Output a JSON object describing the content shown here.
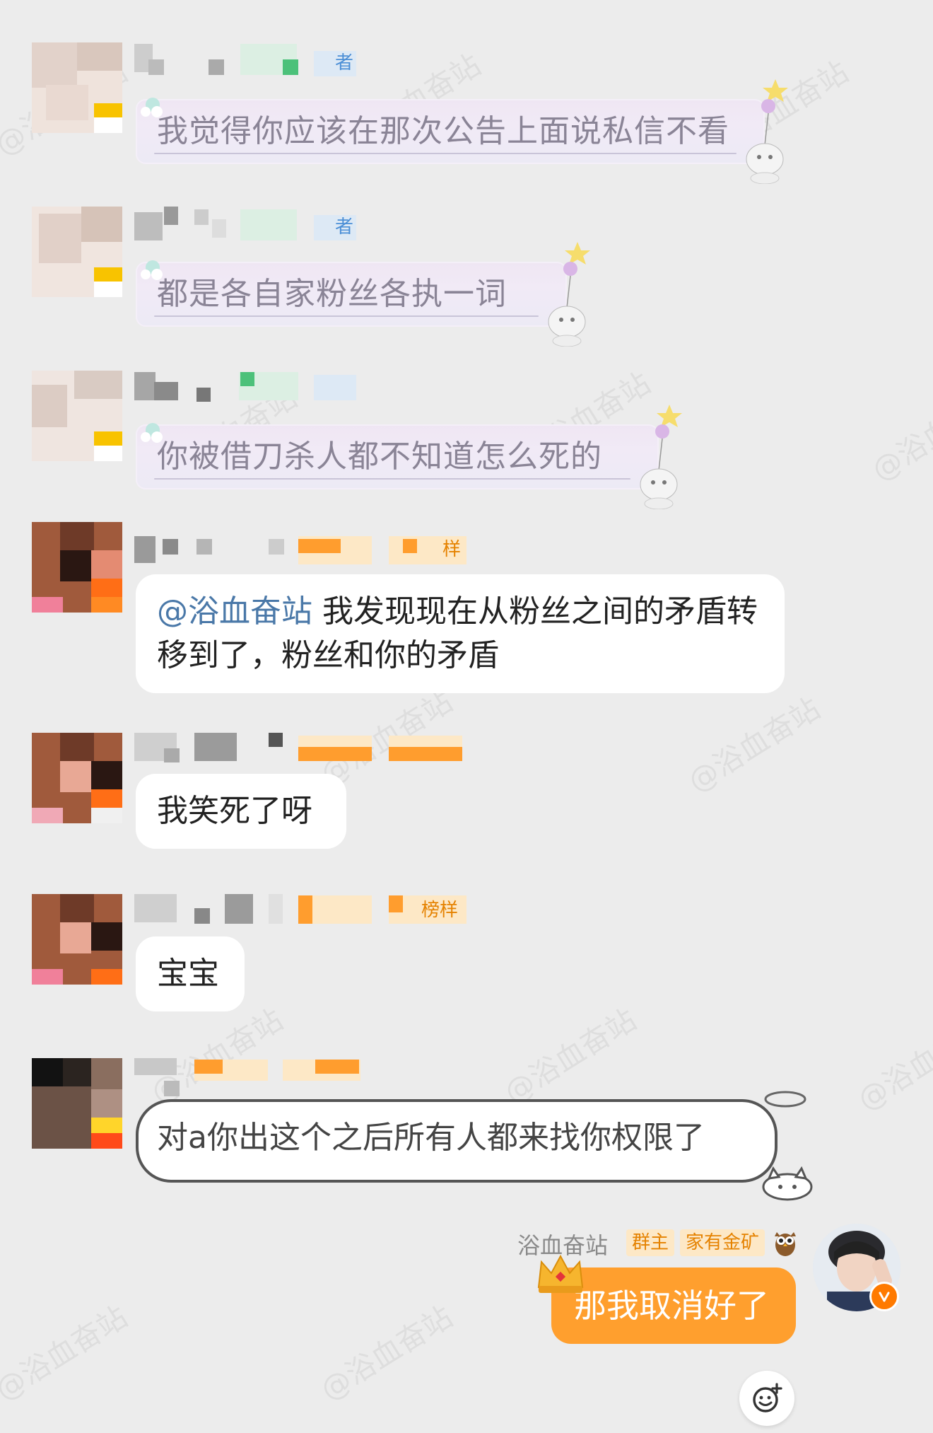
{
  "watermark": "@浴血奋站",
  "messages": [
    {
      "text": "我觉得你应该在那次公告上面说私信不看",
      "badge": "者"
    },
    {
      "text": "都是各自家粉丝各执一词",
      "badge": "者"
    },
    {
      "text": "你被借刀杀人都不知道怎么死的"
    },
    {
      "mention": "@浴血奋站",
      "text": " 我发现现在从粉丝之间的矛盾转移到了，粉丝和你的矛盾",
      "badge": "样"
    },
    {
      "text": "我笑死了呀"
    },
    {
      "text": "宝宝",
      "badge": "榜样"
    },
    {
      "text": "对a你出这个之后所有人都来找你权限了"
    }
  ],
  "self": {
    "name": "浴血奋站",
    "tags": [
      "群主",
      "家有金矿"
    ],
    "message": "那我取消好了"
  },
  "colors": {
    "background": "#ececec",
    "accent_orange": "#ff9f2e",
    "mention_blue": "#4a78a8"
  },
  "icons": [
    "emoji-add-icon",
    "crown-icon",
    "owl-icon",
    "verified-badge-icon"
  ]
}
